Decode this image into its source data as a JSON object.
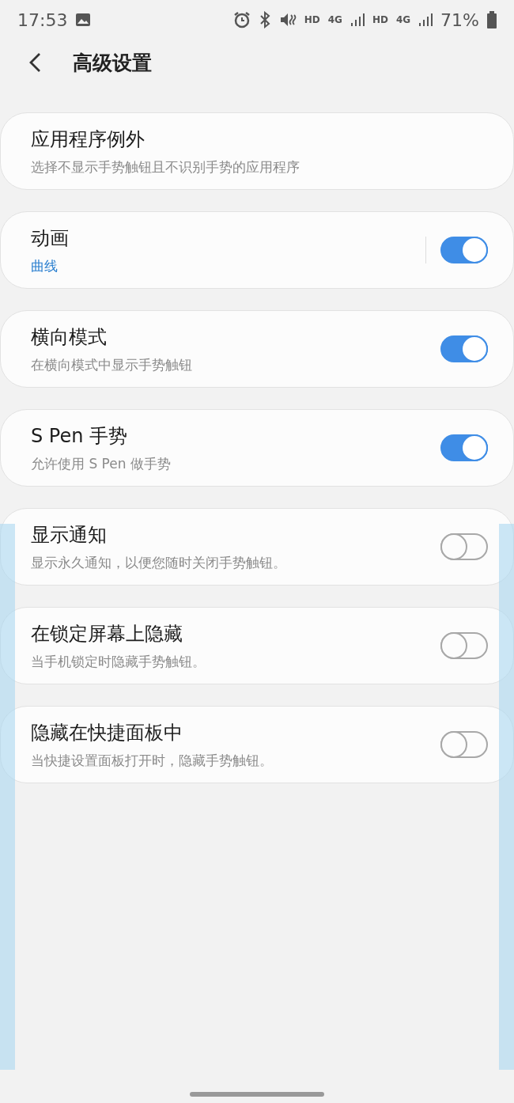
{
  "status_bar": {
    "time": "17:53",
    "network_left": "HD",
    "network_left_type": "4G",
    "network_right": "HD",
    "network_right_type": "4G",
    "battery": "71%"
  },
  "header": {
    "title": "高级设置"
  },
  "items": [
    {
      "kind": "link",
      "title": "应用程序例外",
      "summary": "选择不显示手势触钮且不识别手势的应用程序"
    },
    {
      "kind": "link-switch",
      "title": "动画",
      "value": "曲线",
      "on": true
    },
    {
      "kind": "switch",
      "title": "横向模式",
      "summary": "在横向模式中显示手势触钮",
      "on": true
    },
    {
      "kind": "switch",
      "title": "S Pen 手势",
      "summary": "允许使用 S Pen 做手势",
      "on": true
    },
    {
      "kind": "switch",
      "title": "显示通知",
      "summary": "显示永久通知，以便您随时关闭手势触钮。",
      "on": false
    },
    {
      "kind": "switch",
      "title": "在锁定屏幕上隐藏",
      "summary": "当手机锁定时隐藏手势触钮。",
      "on": false
    },
    {
      "kind": "switch",
      "title": "隐藏在快捷面板中",
      "summary": "当快捷设置面板打开时，隐藏手势触钮。",
      "on": false
    }
  ]
}
